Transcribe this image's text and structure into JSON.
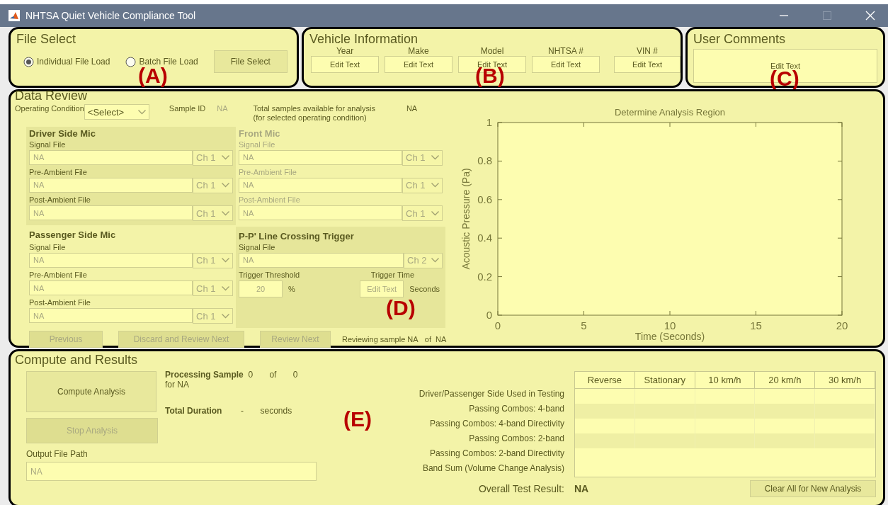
{
  "window": {
    "title": "NHTSA Quiet Vehicle Compliance Tool"
  },
  "file_select": {
    "title": "File Select",
    "annotation": "(A)",
    "options": [
      {
        "label": "Individual File Load",
        "selected": true
      },
      {
        "label": "Batch File Load",
        "selected": false
      }
    ],
    "button": "File Select"
  },
  "vehicle_information": {
    "title": "Vehicle Information",
    "annotation": "(B)",
    "fields": [
      {
        "label": "Year",
        "value": "Edit Text"
      },
      {
        "label": "Make",
        "value": "Edit Text"
      },
      {
        "label": "Model",
        "value": "Edit Text"
      },
      {
        "label": "NHTSA #",
        "value": "Edit Text"
      },
      {
        "label": "VIN #",
        "value": "Edit Text"
      }
    ]
  },
  "user_comments": {
    "title": "User Comments",
    "annotation": "(C)",
    "value": "Edit Text"
  },
  "data_review": {
    "title": "Data Review",
    "annotation": "(D)",
    "operating_condition": {
      "label": "Operating Condition",
      "value": "<Select>"
    },
    "sample_id": {
      "label": "Sample ID",
      "value": "NA"
    },
    "total_samples": {
      "label": "Total samples available for analysis",
      "note": "(for selected operating condition)",
      "value": "NA"
    },
    "mics": [
      {
        "title": "Driver Side Mic",
        "shaded": true,
        "disabled": false,
        "files": [
          {
            "label": "Signal File",
            "value": "NA",
            "channel": "Ch 1"
          },
          {
            "label": "Pre-Ambient File",
            "value": "NA",
            "channel": "Ch 1"
          },
          {
            "label": "Post-Ambient File",
            "value": "NA",
            "channel": "Ch 1"
          }
        ]
      },
      {
        "title": "Front Mic",
        "shaded": false,
        "disabled": true,
        "files": [
          {
            "label": "Signal File",
            "value": "NA",
            "channel": "Ch 1"
          },
          {
            "label": "Pre-Ambient File",
            "value": "NA",
            "channel": "Ch 1"
          },
          {
            "label": "Post-Ambient File",
            "value": "NA",
            "channel": "Ch 1"
          }
        ]
      },
      {
        "title": "Passenger Side Mic",
        "shaded": false,
        "disabled": false,
        "files": [
          {
            "label": "Signal File",
            "value": "NA",
            "channel": "Ch 1"
          },
          {
            "label": "Pre-Ambient File",
            "value": "NA",
            "channel": "Ch 1"
          },
          {
            "label": "Post-Ambient File",
            "value": "NA",
            "channel": "Ch 1"
          }
        ]
      }
    ],
    "trigger": {
      "title": "P-P' Line Crossing Trigger",
      "signal_label": "Signal File",
      "signal_value": "NA",
      "channel": "Ch 2",
      "threshold_label": "Trigger Threshold",
      "threshold_value": "20",
      "threshold_unit": "%",
      "time_label": "Trigger Time",
      "time_value": "Edit Text",
      "time_unit": "Seconds"
    },
    "nav_buttons": [
      {
        "label": "Previous",
        "disabled": true
      },
      {
        "label": "Discard and Review Next",
        "disabled": true
      },
      {
        "label": "Review Next",
        "disabled": true
      }
    ],
    "reviewing": {
      "label": "Reviewing sample",
      "current": "NA",
      "of": "of",
      "total": "NA"
    },
    "chart_data": {
      "type": "line",
      "title": "Determine Analysis Region",
      "xlabel": "Time (Seconds)",
      "ylabel": "Acoustic Pressure (Pa)",
      "xlim": [
        0,
        20
      ],
      "ylim": [
        0,
        1
      ],
      "xticks": [
        0,
        5,
        10,
        15,
        20
      ],
      "yticks": [
        0,
        0.2,
        0.4,
        0.6,
        0.8,
        1
      ]
    }
  },
  "compute_and_results": {
    "title": "Compute and Results",
    "annotation": "(E)",
    "buttons": [
      {
        "label": "Compute Analysis",
        "disabled": false
      },
      {
        "label": "Stop Analysis",
        "disabled": true
      }
    ],
    "processing": {
      "label": "Processing Sample",
      "current": "0",
      "of": "of",
      "total": "0",
      "for_text": "for NA"
    },
    "duration": {
      "label": "Total Duration",
      "value": "-",
      "unit": "seconds"
    },
    "output": {
      "label": "Output File Path",
      "value": "NA"
    },
    "table": {
      "columns": [
        "Reverse",
        "Stationary",
        "10 km/h",
        "20 km/h",
        "30 km/h"
      ],
      "row_labels": [
        "Driver/Passenger Side Used in Testing",
        "Passing Combos: 4-band",
        "Passing Combos: 4-band Directivity",
        "Passing Combos: 2-band",
        "Passing Combos: 2-band Directivity",
        "Band Sum (Volume Change Analysis)"
      ]
    },
    "overall": {
      "label": "Overall Test Result:",
      "value": "NA"
    },
    "clear_button": "Clear All for New Analysis"
  }
}
